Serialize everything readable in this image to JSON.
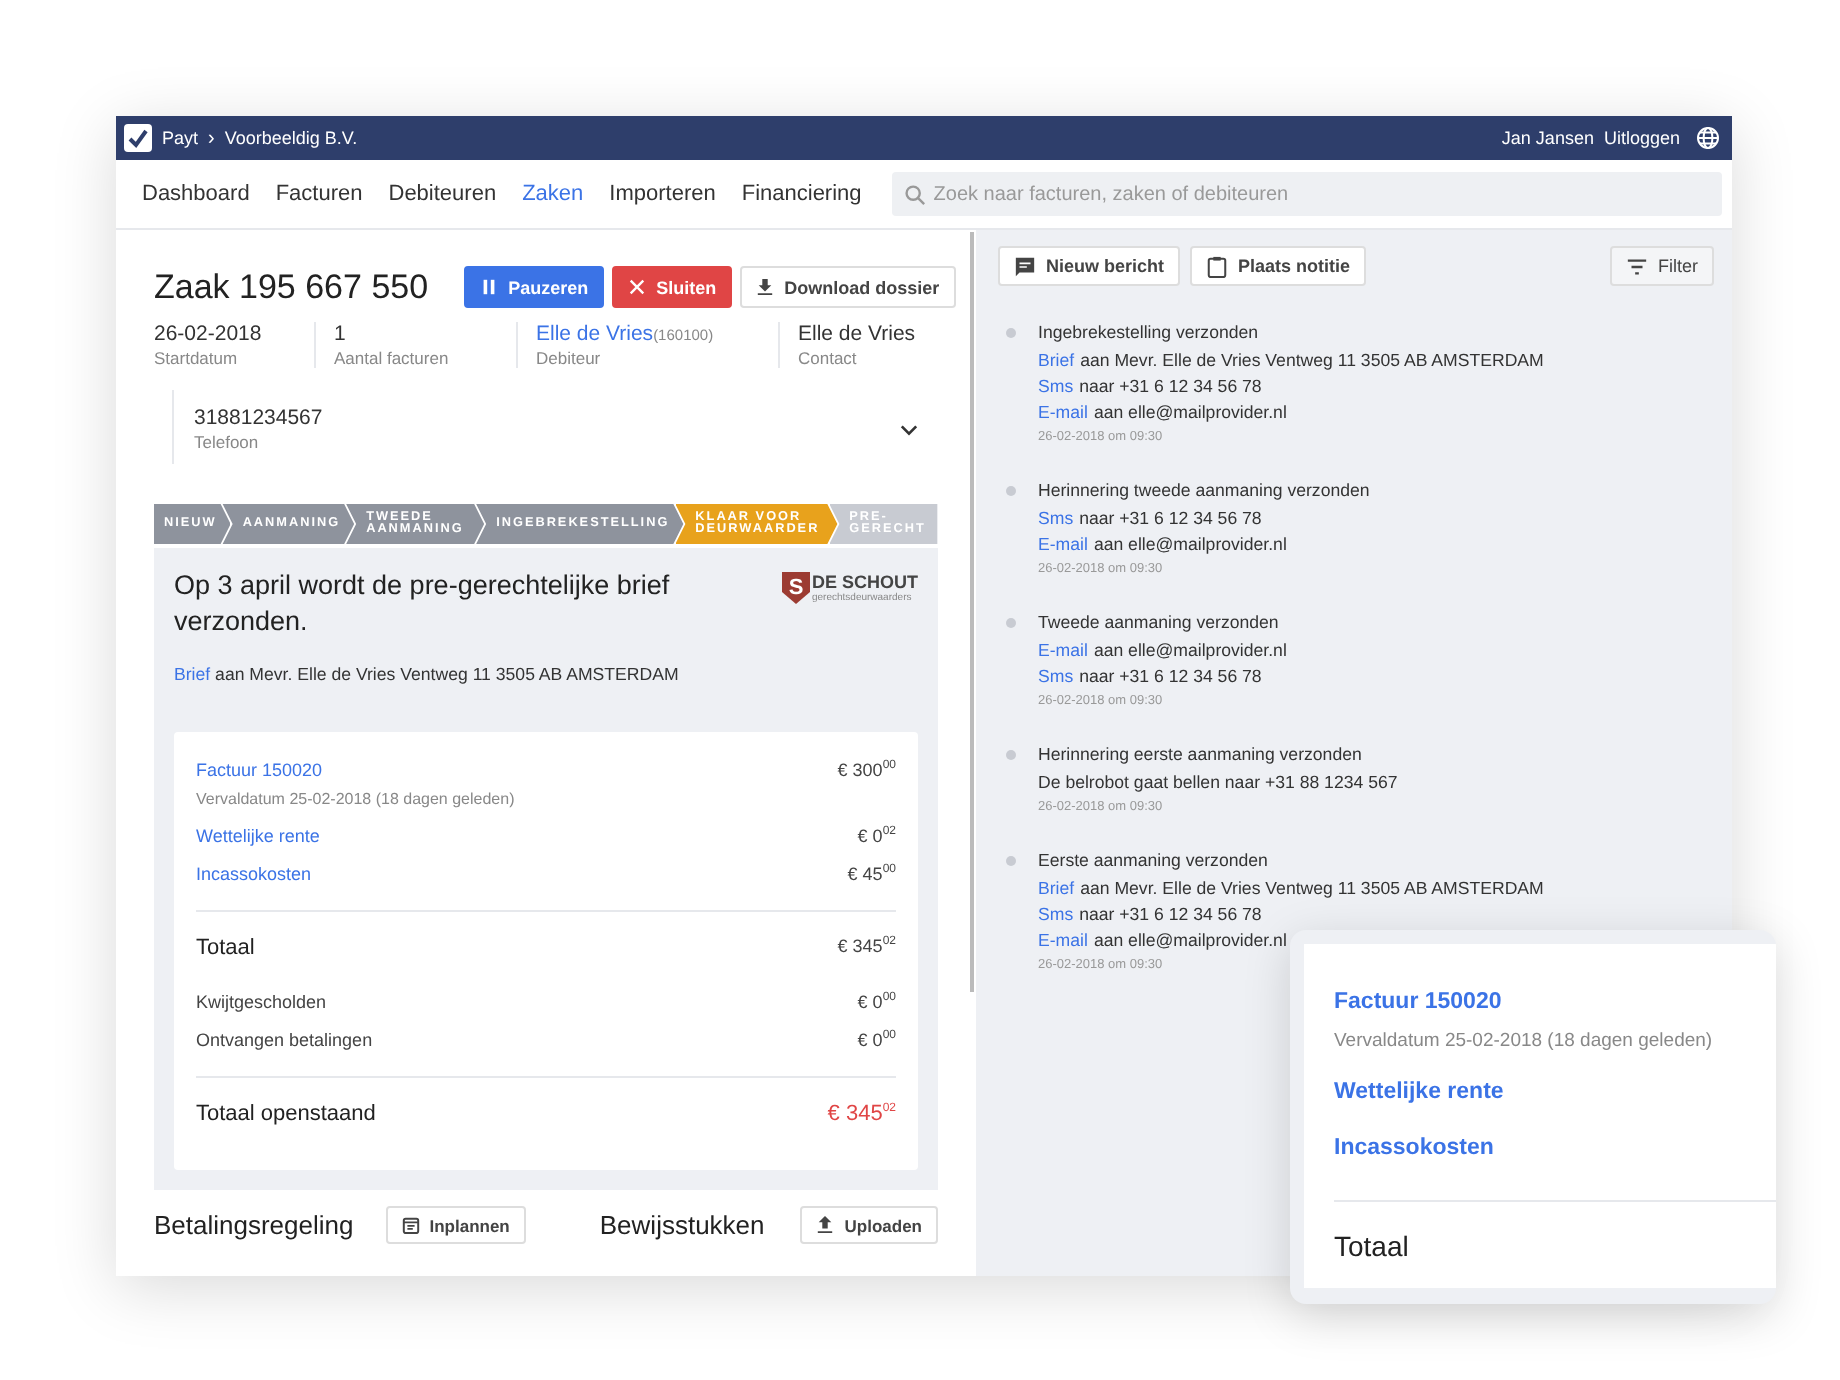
{
  "topbar": {
    "app": "Payt",
    "separator": "›",
    "company": "Voorbeeldig B.V.",
    "user": "Jan Jansen",
    "logout": "Uitloggen"
  },
  "nav": {
    "items": [
      {
        "label": "Dashboard",
        "selected": false
      },
      {
        "label": "Facturen",
        "selected": false
      },
      {
        "label": "Debiteuren",
        "selected": false
      },
      {
        "label": "Zaken",
        "selected": true
      },
      {
        "label": "Importeren",
        "selected": false
      },
      {
        "label": "Financiering",
        "selected": false
      }
    ],
    "search": {
      "placeholder": "Zoek naar facturen, zaken of debiteuren"
    }
  },
  "case": {
    "title": "Zaak 195 667 550",
    "buttons": [
      {
        "kind": "pause",
        "label": "Pauzeren"
      },
      {
        "kind": "close",
        "label": "Sluiten"
      },
      {
        "kind": "download",
        "label": "Download dossier"
      }
    ],
    "facts": [
      {
        "value": "26-02-2018",
        "label": "Startdatum"
      },
      {
        "value": "1",
        "label": "Aantal facturen"
      },
      {
        "value": "Elle de Vries",
        "extra": "(160100)",
        "label": "Debiteur",
        "link": true
      },
      {
        "value": "Elle de Vries",
        "label": "Contact"
      }
    ],
    "phone": {
      "value": "31881234567",
      "label": "Telefoon",
      "expanded": false
    }
  },
  "steps": [
    {
      "label": "NIEUW",
      "done": true,
      "selected": false
    },
    {
      "label": "AANMANING",
      "done": true,
      "selected": false
    },
    {
      "label": "TWEEDE AANMANING",
      "done": true,
      "selected": false
    },
    {
      "label": "INGEBREKESTELLING",
      "done": true,
      "selected": false
    },
    {
      "label": "KLAAR VOOR DEURWAARDER",
      "done": false,
      "selected": true
    },
    {
      "label": "PRE-GERECHT",
      "done": false,
      "selected": false
    }
  ],
  "notice": {
    "title": "Op 3 april wordt de pre-gerechtelijke brief verzonden.",
    "logo": {
      "mark": "S",
      "name": "DE SCHOUT",
      "tagline": "gerechtsdeurwaarders"
    },
    "letter": {
      "link": "Brief",
      "text": "aan Mevr. Elle de Vries Ventweg 11 3505 AB AMSTERDAM"
    }
  },
  "invoice": {
    "items": [
      {
        "label": "Factuur 150020",
        "sub": "Vervaldatum 25-02-2018 (18 dagen geleden)",
        "amount": "€ 300$^{00}$"
      },
      {
        "label": "Wettelijke rente",
        "amount": "€ 0$^{02}$"
      },
      {
        "label": "Incassokosten",
        "amount": "€ 45$^{00}$"
      }
    ],
    "total": {
      "label": "Totaal",
      "amount": "€ 345$^{02}$"
    },
    "adjustments": [
      {
        "label": "Kwijtgescholden",
        "amount": "€ 0$^{00}$"
      },
      {
        "label": "Ontvangen betalingen",
        "amount": "€ 0$^{00}$"
      }
    ],
    "outstanding": {
      "label": "Totaal openstaand",
      "amount": "€ 345$^{02}$"
    }
  },
  "bottom": [
    {
      "title": "Betalingsregeling",
      "button": "Inplannen",
      "kind": "calendar"
    },
    {
      "title": "Bewijsstukken",
      "button": "Uploaden",
      "kind": "upload"
    }
  ],
  "activity": {
    "buttons": [
      {
        "kind": "message",
        "label": "Nieuw bericht"
      },
      {
        "kind": "note",
        "label": "Plaats notitie"
      }
    ],
    "filter": "Filter",
    "events": [
      {
        "title": "Ingebrekestelling verzonden",
        "lines": [
          {
            "link": "Brief",
            "text": "aan Mevr. Elle de Vries Ventweg 11 3505 AB AMSTERDAM"
          },
          {
            "link": "Sms",
            "text": "naar +31 6 12 34 56 78"
          },
          {
            "link": "E-mail",
            "text": "aan elle@mailprovider.nl"
          }
        ],
        "time": "26-02-2018 om 09:30"
      },
      {
        "title": "Herinnering tweede aanmaning verzonden",
        "lines": [
          {
            "link": "Sms",
            "text": "naar +31 6 12 34 56 78"
          },
          {
            "link": "E-mail",
            "text": "aan elle@mailprovider.nl"
          }
        ],
        "time": "26-02-2018 om 09:30"
      },
      {
        "title": "Tweede aanmaning verzonden",
        "lines": [
          {
            "link": "E-mail",
            "text": "aan elle@mailprovider.nl"
          },
          {
            "link": "Sms",
            "text": "naar +31 6 12 34 56 78"
          }
        ],
        "time": "26-02-2018 om 09:30"
      },
      {
        "title": "Herinnering eerste aanmaning verzonden",
        "lines": [
          {
            "text": "De belrobot gaat bellen naar +31 88 1234 567"
          }
        ],
        "time": "26-02-2018 om 09:30"
      },
      {
        "title": "Eerste aanmaning verzonden",
        "lines": [
          {
            "link": "Brief",
            "text": "aan Mevr. Elle de Vries Ventweg 11 3505 AB AMSTERDAM"
          },
          {
            "link": "Sms",
            "text": "naar +31 6 12 34 56 78"
          },
          {
            "link": "E-mail",
            "text": "aan elle@mailprovider.nl"
          }
        ],
        "time": "26-02-2018 om 09:30"
      }
    ]
  },
  "zoom_card": {
    "items": [
      {
        "label": "Factuur 150020",
        "sub": "Vervaldatum 25-02-2018 (18 dagen geleden)"
      },
      {
        "label": "Wettelijke rente"
      },
      {
        "label": "Incassokosten"
      }
    ],
    "total": "Totaal"
  }
}
